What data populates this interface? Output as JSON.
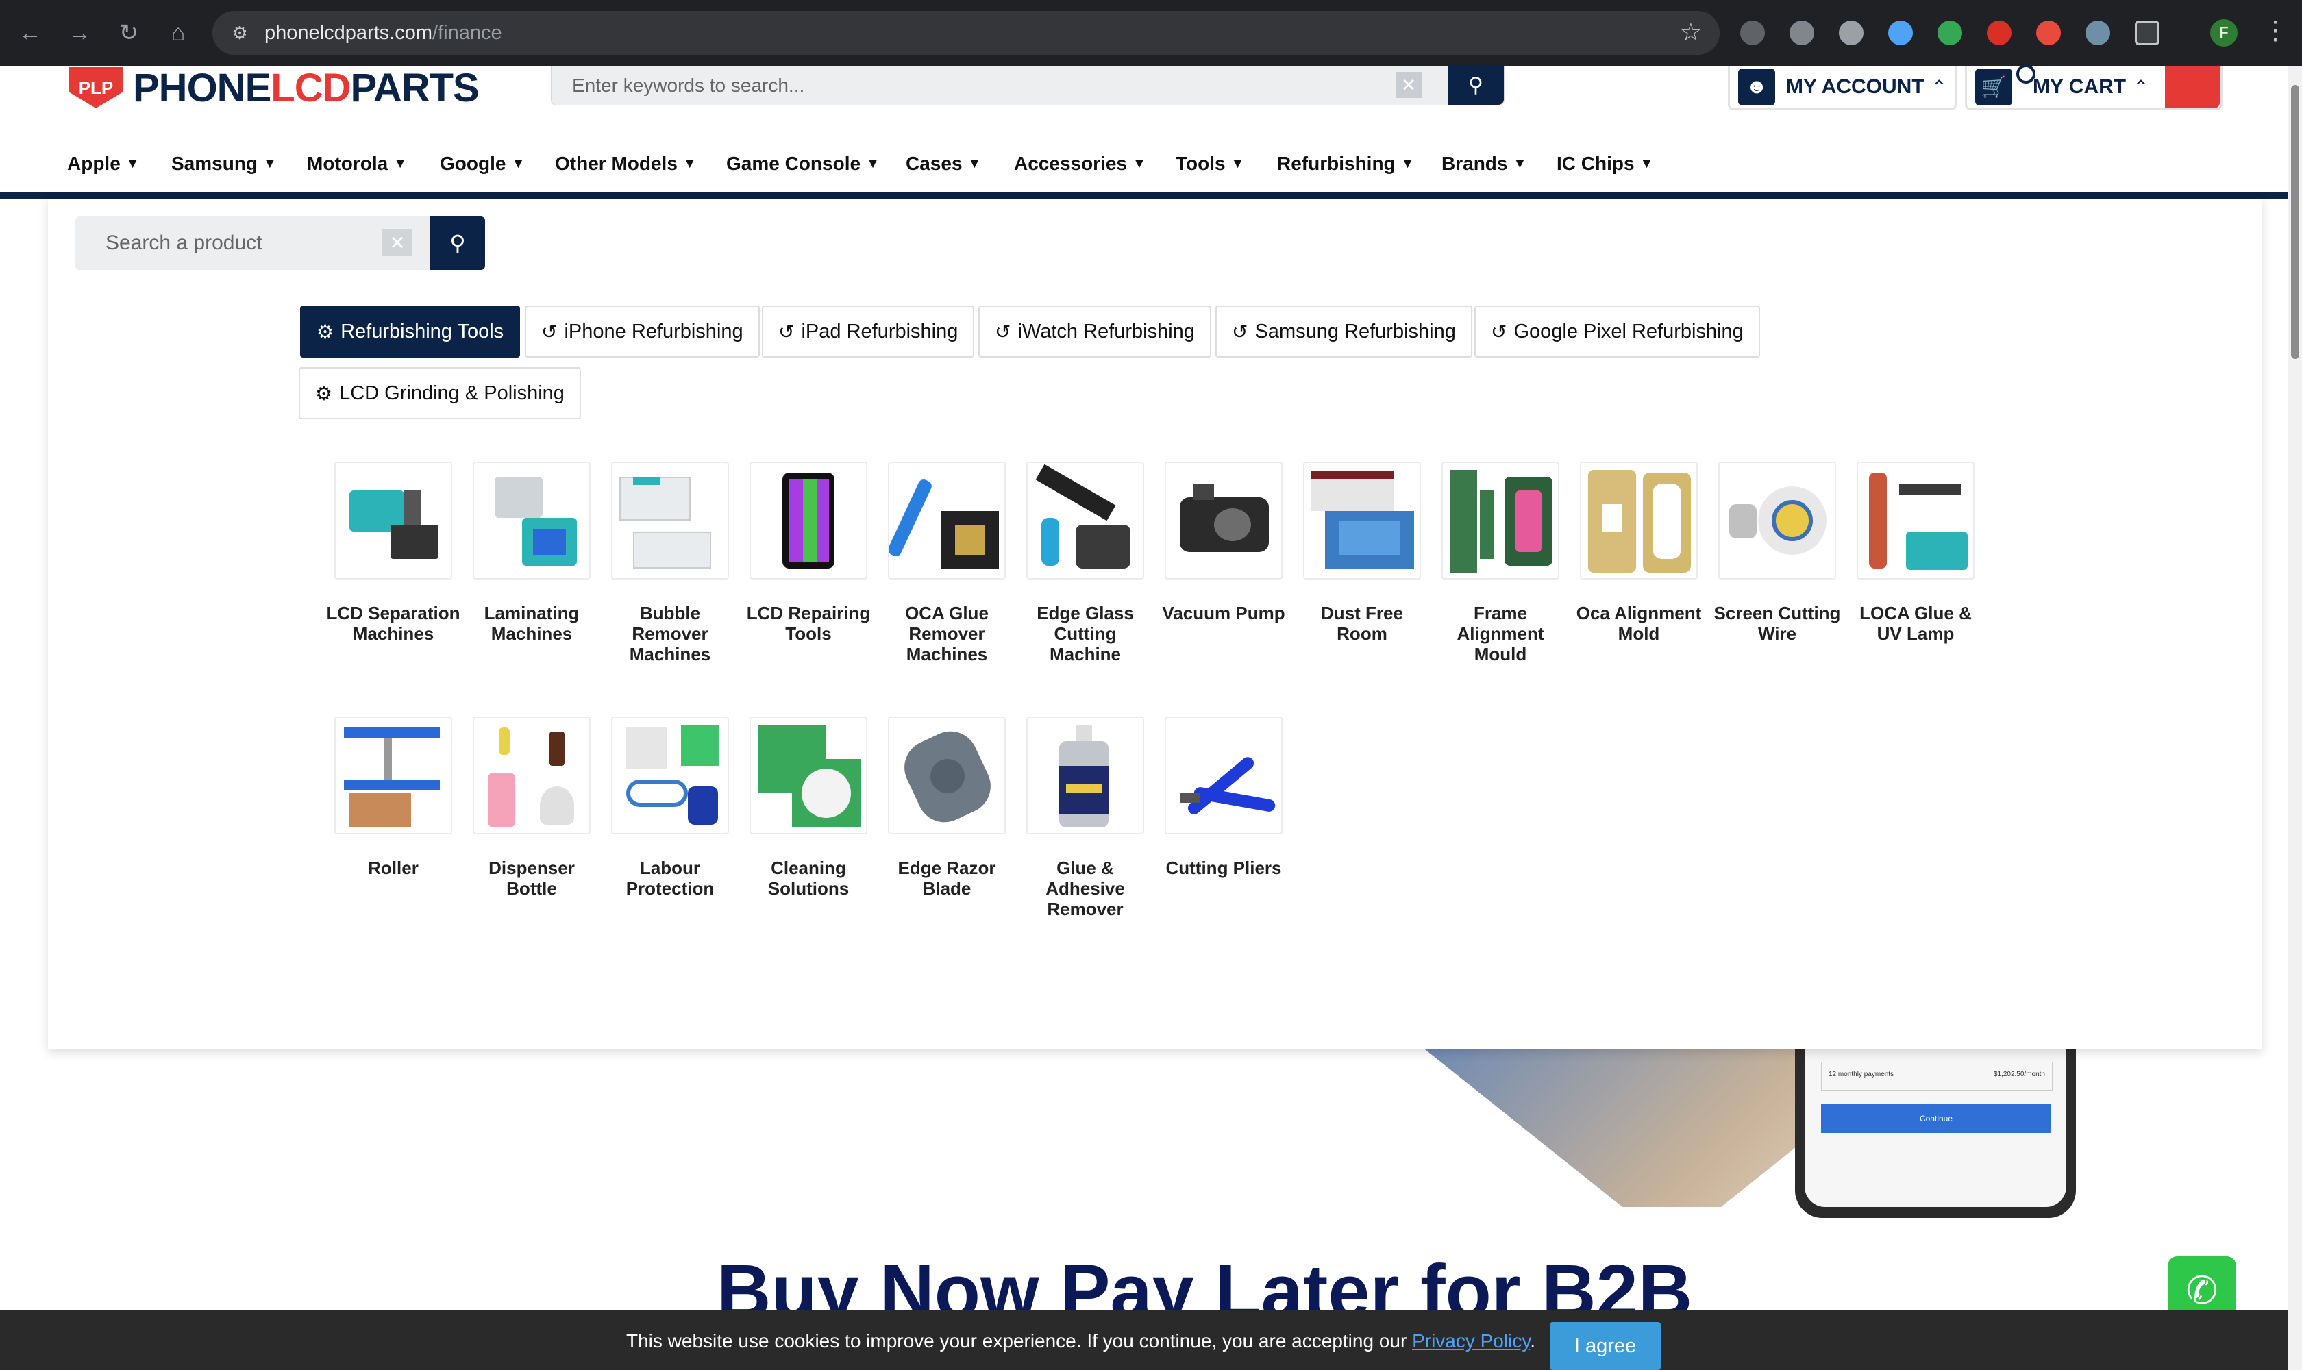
{
  "browser": {
    "url_host": "phonelcdparts.com",
    "url_path": "/finance",
    "profile_initial": "F"
  },
  "header": {
    "logo_badge": "PLP",
    "logo_part1": "PHONE",
    "logo_part2": "LCD",
    "logo_part3": "PARTS",
    "search_placeholder": "Enter keywords to search...",
    "account_label": "MY ACCOUNT",
    "cart_label": "MY CART"
  },
  "nav": [
    "Apple",
    "Samsung",
    "Motorola",
    "Google",
    "Other Models",
    "Game Console",
    "Cases",
    "Accessories",
    "Tools",
    "Refurbishing",
    "Brands",
    "IC Chips"
  ],
  "panel": {
    "search_placeholder": "Search a product",
    "tabs": [
      {
        "label": "Refurbishing Tools",
        "icon": "gear-icon",
        "active": true
      },
      {
        "label": "iPhone Refurbishing",
        "icon": "undo-icon",
        "active": false
      },
      {
        "label": "iPad Refurbishing",
        "icon": "undo-icon",
        "active": false
      },
      {
        "label": "iWatch Refurbishing",
        "icon": "undo-icon",
        "active": false
      },
      {
        "label": "Samsung Refurbishing",
        "icon": "undo-icon",
        "active": false
      },
      {
        "label": "Google Pixel Refurbishing",
        "icon": "undo-icon",
        "active": false
      },
      {
        "label": "LCD Grinding & Polishing",
        "icon": "gear-icon",
        "active": false
      }
    ],
    "categories": [
      {
        "label": "LCD Separation Machines",
        "icon": "lcd-separation-machine-image"
      },
      {
        "label": "Laminating Machines",
        "icon": "laminating-machine-image"
      },
      {
        "label": "Bubble Remover Machines",
        "icon": "bubble-remover-image"
      },
      {
        "label": "LCD Repairing Tools",
        "icon": "lcd-repair-tool-image"
      },
      {
        "label": "OCA Glue Remover Machines",
        "icon": "oca-glue-remover-image"
      },
      {
        "label": "Edge Glass Cutting Machine",
        "icon": "edge-glass-cutter-image"
      },
      {
        "label": "Vacuum Pump",
        "icon": "vacuum-pump-image"
      },
      {
        "label": "Dust Free Room",
        "icon": "dust-free-room-image"
      },
      {
        "label": "Frame Alignment Mould",
        "icon": "frame-alignment-mould-image"
      },
      {
        "label": "Oca Alignment Mold",
        "icon": "oca-alignment-mold-image"
      },
      {
        "label": "Screen Cutting Wire",
        "icon": "cutting-wire-image"
      },
      {
        "label": "LOCA Glue & UV Lamp",
        "icon": "loca-glue-image"
      },
      {
        "label": "Roller",
        "icon": "roller-image"
      },
      {
        "label": "Dispenser Bottle",
        "icon": "dispenser-bottle-image"
      },
      {
        "label": "Labour Protection",
        "icon": "labour-protection-image"
      },
      {
        "label": "Cleaning Solutions",
        "icon": "cleaning-solution-image"
      },
      {
        "label": "Edge Razor Blade",
        "icon": "razor-blade-image"
      },
      {
        "label": "Glue & Adhesive Remover",
        "icon": "adhesive-remover-image"
      },
      {
        "label": "Cutting Pliers",
        "icon": "cutting-pliers-image"
      }
    ]
  },
  "page": {
    "headline": "Buy Now Pay Later for B2B",
    "phone_row_label": "12 monthly payments",
    "phone_row_value": "$1,202.50/month",
    "phone_button": "Continue"
  },
  "cookie": {
    "text": "This website use cookies to improve your experience. If you continue, you are accepting our",
    "link": "Privacy Policy",
    "suffix": ".",
    "agree": "I agree"
  },
  "colors": {
    "brand_navy": "#0b2346",
    "brand_red": "#e53935",
    "cookie_button": "#3b9cd9"
  }
}
